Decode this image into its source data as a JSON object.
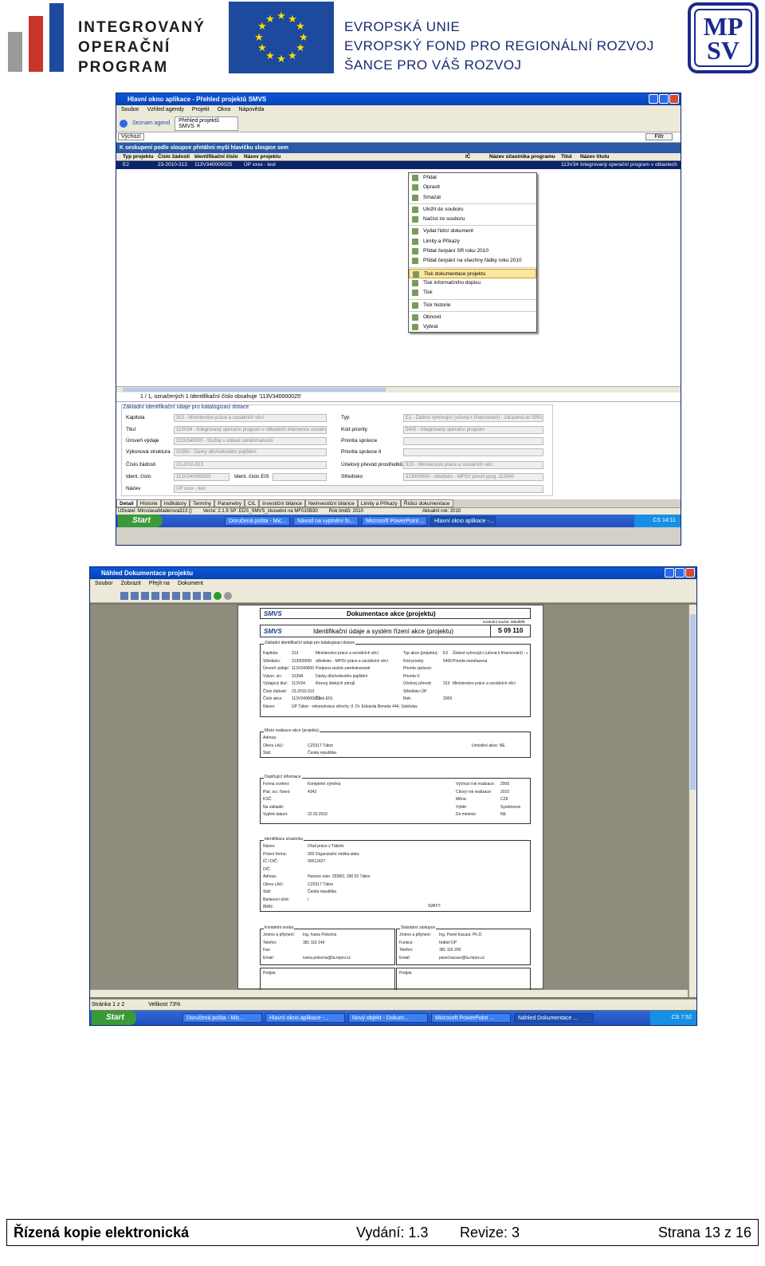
{
  "header": {
    "iop_lines": [
      "INTEGROVANÝ",
      "OPERAČNÍ",
      "PROGRAM"
    ],
    "eu_lines": [
      "EVROPSKÁ UNIE",
      "EVROPSKÝ FOND PRO REGIONÁLNÍ ROZVOJ",
      "ŠANCE PRO VÁŠ ROZVOJ"
    ],
    "mpsv_top": "MP",
    "mpsv_bottom": "SV",
    "brand_colors": {
      "iop_red": "#c8352a",
      "iop_grey": "#9a9a9a",
      "iop_blue": "#1d4a9c",
      "eu_blue": "#1d4a9c",
      "eu_star": "#ffdd00",
      "mpsv_blue": "#1a2a8c"
    }
  },
  "screen1": {
    "title": "Hlavní okno aplikace - Přehled projektů SMVS",
    "menu": [
      "Soubor",
      "Vzhled agendy",
      "Projekt",
      "Okno",
      "Nápověda"
    ],
    "tab_agendas": "Seznam agend",
    "tab_overview": "Přehled projektů SMVS",
    "view_label": "Výchozí",
    "filter_button": "Filtr",
    "group_hint": "K seskupení podle sloupce přetáhni myší hlavičku sloupce sem",
    "columns": [
      "Typ projektu",
      "Číslo žádosti",
      "Identifikační číslo",
      "Název projektu",
      "IČ",
      "Název účastníka programu",
      "Titul",
      "Název titulu"
    ],
    "row": [
      "E2",
      "23-2010-313",
      "113V340000025",
      "ÚP xxxx - test",
      "",
      "",
      "113V34",
      "Integrovaný operační program v oblastech inte"
    ],
    "context_menu": {
      "groups": [
        [
          "Přidat",
          "Opravit",
          "Smazat"
        ],
        [
          "Uložit do souboru",
          "Načíst ze souboru"
        ],
        [
          "Vydat řídící dokument",
          "Limity a Příkazy",
          "Přidat čerpání SR roku 2010",
          "Přidat čerpání na všechny řádky roku 2010"
        ],
        [
          "Tisk dokumentace projektu",
          "Tisk informačního dopisu",
          "Tisk"
        ],
        [
          "Tisk historie"
        ],
        [
          "Obnovit",
          "Vybrat"
        ]
      ],
      "selected": "Tisk dokumentace projektu"
    },
    "status_line": "1 / 1, označených 1  Identifikační číslo obsahuje '113V340000025'",
    "detail_section": "Základní identifikační údaje pro katalogizaci dotace",
    "fields_left": [
      {
        "label": "Kapitola",
        "value": "313 - Ministerstvo práce a sociálních věcí"
      },
      {
        "label": "Titul",
        "value": "113V34 - Integrovaný operační program v oblastech intervence sociáln"
      },
      {
        "label": "Úroveň výdaje",
        "value": "113V340000 - Služby v oblasti zaměstnanosti"
      },
      {
        "label": "Výkonová struktura",
        "value": "3139A - Dávky důchodového pojištění"
      },
      {
        "label": "Číslo žádosti",
        "value": "23-2010-313"
      },
      {
        "label": "Ident. číslo",
        "value": "113V340000025"
      },
      {
        "label": "Název",
        "value": "ÚP xxxx - test"
      }
    ],
    "ident_eis_label": "Ident. číslo EIS",
    "fields_right": [
      {
        "label": "Typ",
        "value": "E2 - Žádost vyhovující (učená k financování) - zařazená do SRU"
      },
      {
        "label": "Kód priority",
        "value": "5400 - Integrovaný operační program"
      },
      {
        "label": "Priorita správce",
        "value": ""
      },
      {
        "label": "Priorita správce II",
        "value": ""
      },
      {
        "label": "Účelový převod prostředků",
        "value": "313 - Ministerstvo práce a sociálních věcí"
      },
      {
        "label": "Středisko",
        "value": "313000000 - středisko - MPSV povolí pprg. 113340"
      }
    ],
    "detail_tabs": [
      "Detail",
      "Historie",
      "Indikátory",
      "Termíny",
      "Parametry",
      "CIL",
      "Investiční bilance",
      "Neinvestiční bilance",
      "Limity a Příkazy",
      "Řídící dokumentace"
    ],
    "user_status": "Uživatel: MiroslavaMaderova313 ()",
    "version_status": "Verze: 2.1.9 SP: EDS_SMVS_zkusebni na MF010B30",
    "year_limit": "Rok limitů: 2010",
    "current_year": "Aktuální rok: 2010",
    "taskbar": {
      "start": "Start",
      "tasks": [
        "Doručená pošta - Mic...",
        "Návod na vyplnění fo...",
        "Microsoft PowerPoint ...",
        "Hlavní okno aplikace -..."
      ],
      "lang": "CS",
      "time": "14:11"
    }
  },
  "screen2": {
    "title": "Náhled Dokumentace projektu",
    "menu": [
      "Soubor",
      "Zobrazit",
      "Přejít na",
      "Dokument"
    ],
    "doc_header_title": "Dokumentace akce (projektu)",
    "doc_subtitle": "Identifikační údaje a systém řízení akce (projektu)",
    "doc_code": "S 09 110",
    "doc_logo": "SMVS",
    "doc_control": "Kontrolní součet: 0064f6f8",
    "box1": {
      "caption": "Základní identifikační údaje pro katalogizaci dotace",
      "lines": [
        [
          "Kapitola:",
          "313",
          "Ministerstvo práce a sociálních věcí",
          "Typ akce (projektu):",
          "E2",
          "Žádost vyhovující (učená k financování) - zařazená do SRU"
        ],
        [
          "Středisko:",
          "313000000",
          "středisko - MPSV práce a sociálních věcí",
          "Kód priority:",
          "5400",
          "Priorita nezařazená"
        ],
        [
          "Úroveň výdaje:",
          "113V340000",
          "Podpora služeb zaměstnanosti",
          "Priorita správce:",
          "",
          ""
        ],
        [
          "Výkon. str.:",
          "3139A",
          "Dávky důchodového pojištění",
          "Priorita II:",
          "",
          ""
        ],
        [
          "Výdajový titul:",
          "113V34",
          "Rozvoj lidských zdrojů",
          "Účelový převod:",
          "313",
          "Ministerstvo práce a sociálních věcí"
        ],
        [
          "Číslo žádosti:",
          "23-2010-313",
          "",
          "Středisko ÚP:",
          "",
          ""
        ],
        [
          "Číslo akce:",
          "113V340000025",
          "Číslo EIS:",
          "Rok:",
          "2009",
          ""
        ],
        [
          "Název:",
          "ÚP Tábor - rekonstrukce střechy, tř. Dr. Edvarda Beneše 444, Soběslav",
          "",
          "",
          "",
          ""
        ]
      ]
    },
    "box2": {
      "caption": "Místo realizace akce (projektu)",
      "lines": [
        [
          "Adresa:",
          "",
          ""
        ],
        [
          "Okres LAU:",
          "CZ0317 Tábor",
          "Umístění akce: NE"
        ],
        [
          "Stát:",
          "Česká republika",
          ""
        ]
      ]
    },
    "box3": {
      "caption": "Doplňující informace",
      "lines": [
        [
          "Forma ocelení:",
          "Kompletní výměna",
          "Výchozí rok realizace:",
          "2009"
        ],
        [
          "Plat. ocr. řízení:",
          "4343",
          "Cílový rok realizace:",
          "2010"
        ],
        [
          "KSČ:",
          "",
          "Měna:",
          "CZK"
        ],
        [
          "Na základě:",
          "",
          "Výběr:",
          "Systémová"
        ],
        [
          "Vyplnit datum:",
          "22.03.2010",
          "De minimis:",
          "NE"
        ]
      ]
    },
    "box4": {
      "caption": "Identifikace účastníka",
      "lines": [
        [
          "Název:",
          "Úřad práce v Táboře"
        ],
        [
          "Právní forma:",
          "325  Organizační složka státu"
        ],
        [
          "IČ / DIČ:",
          "00512427"
        ],
        [
          "DIČ:",
          ""
        ],
        [
          "Adresa:",
          "Husovo nám. 2938/2, 390 02 Tábor"
        ],
        [
          "Okres LAU:",
          "CZ0317 Tábor"
        ],
        [
          "Stát:",
          "Česká republika"
        ],
        [
          "Bankovní účet:",
          "/"
        ],
        [
          "IBAN:",
          ""
        ]
      ],
      "swift": "SWIFT:"
    },
    "box5": {
      "caption": "Kontaktní osoba",
      "lines": [
        [
          "Jméno a příjmení:",
          "Ing. Ivana Pokorná"
        ],
        [
          "Telefon:",
          "381 116 140"
        ],
        [
          "Fax:",
          ""
        ],
        [
          "Email:",
          "ivana.pokorna@ta.mpsv.cz"
        ]
      ]
    },
    "box6": {
      "caption": "Statutární zástupce",
      "lines": [
        [
          "Jméno a příjmení:",
          "Ing. Pavel Kacaur, Ph.D."
        ],
        [
          "Funkce:",
          "ředitel ÚP"
        ],
        [
          "Telefon:",
          "381 116 200"
        ],
        [
          "Email:",
          "pavel.kacaur@ta.mpsv.cz"
        ]
      ]
    },
    "signature_left": "Podpis:",
    "signature_right": "Podpis:",
    "status_page": "Stránka 1 z 2",
    "status_zoom": "Velikost 73%",
    "taskbar": {
      "start": "Start",
      "tasks": [
        "Doručená pošta - Mic...",
        "Hlavní okno aplikace -...",
        "Nový objekt - Dokum...",
        "Microsoft PowerPoint ...",
        "Náhled Dokumentace ..."
      ],
      "lang": "CS",
      "time": "7:52"
    }
  },
  "footer": {
    "left": "Řízená kopie elektronická",
    "edition": "Vydání: 1.3",
    "revision": "Revize: 3",
    "page": "Strana 13 z 16"
  }
}
